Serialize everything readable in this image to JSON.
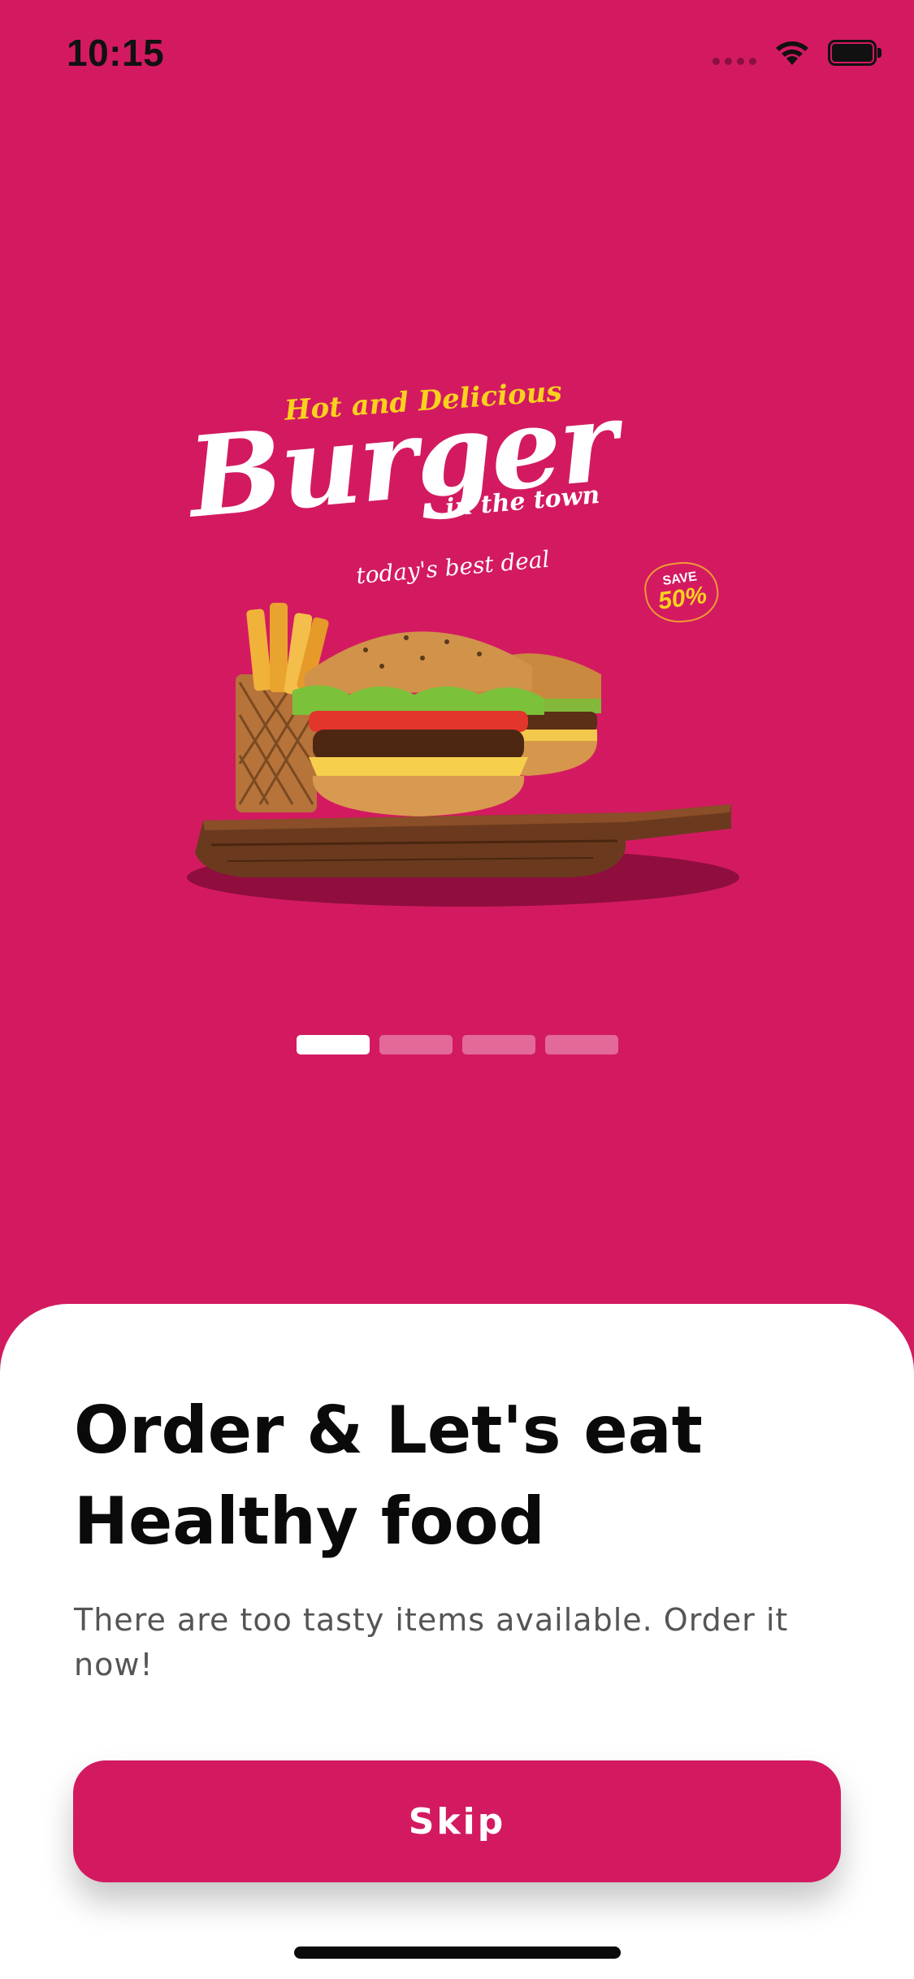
{
  "status_bar": {
    "time": "10:15",
    "icons": [
      "signal-icon",
      "wifi-icon",
      "battery-icon"
    ]
  },
  "hero": {
    "title_small": "Hot and Delicious",
    "title_big": "Burger",
    "title_sub": "in the town",
    "tagline": "today's best deal",
    "save_label": "SAVE",
    "save_value": "50%",
    "image": "burger-and-fries-on-wooden-board"
  },
  "pager": {
    "total": 4,
    "active_index": 0
  },
  "onboarding": {
    "title": "Order & Let's eat Healthy food",
    "description": "There are too tasty items available. Order it now!",
    "skip_label": "Skip"
  },
  "colors": {
    "brand": "#D31A61",
    "accent": "#F9D21E",
    "sheet": "#FFFFFF",
    "text_primary": "#0A0A0A",
    "text_secondary": "#555555"
  }
}
